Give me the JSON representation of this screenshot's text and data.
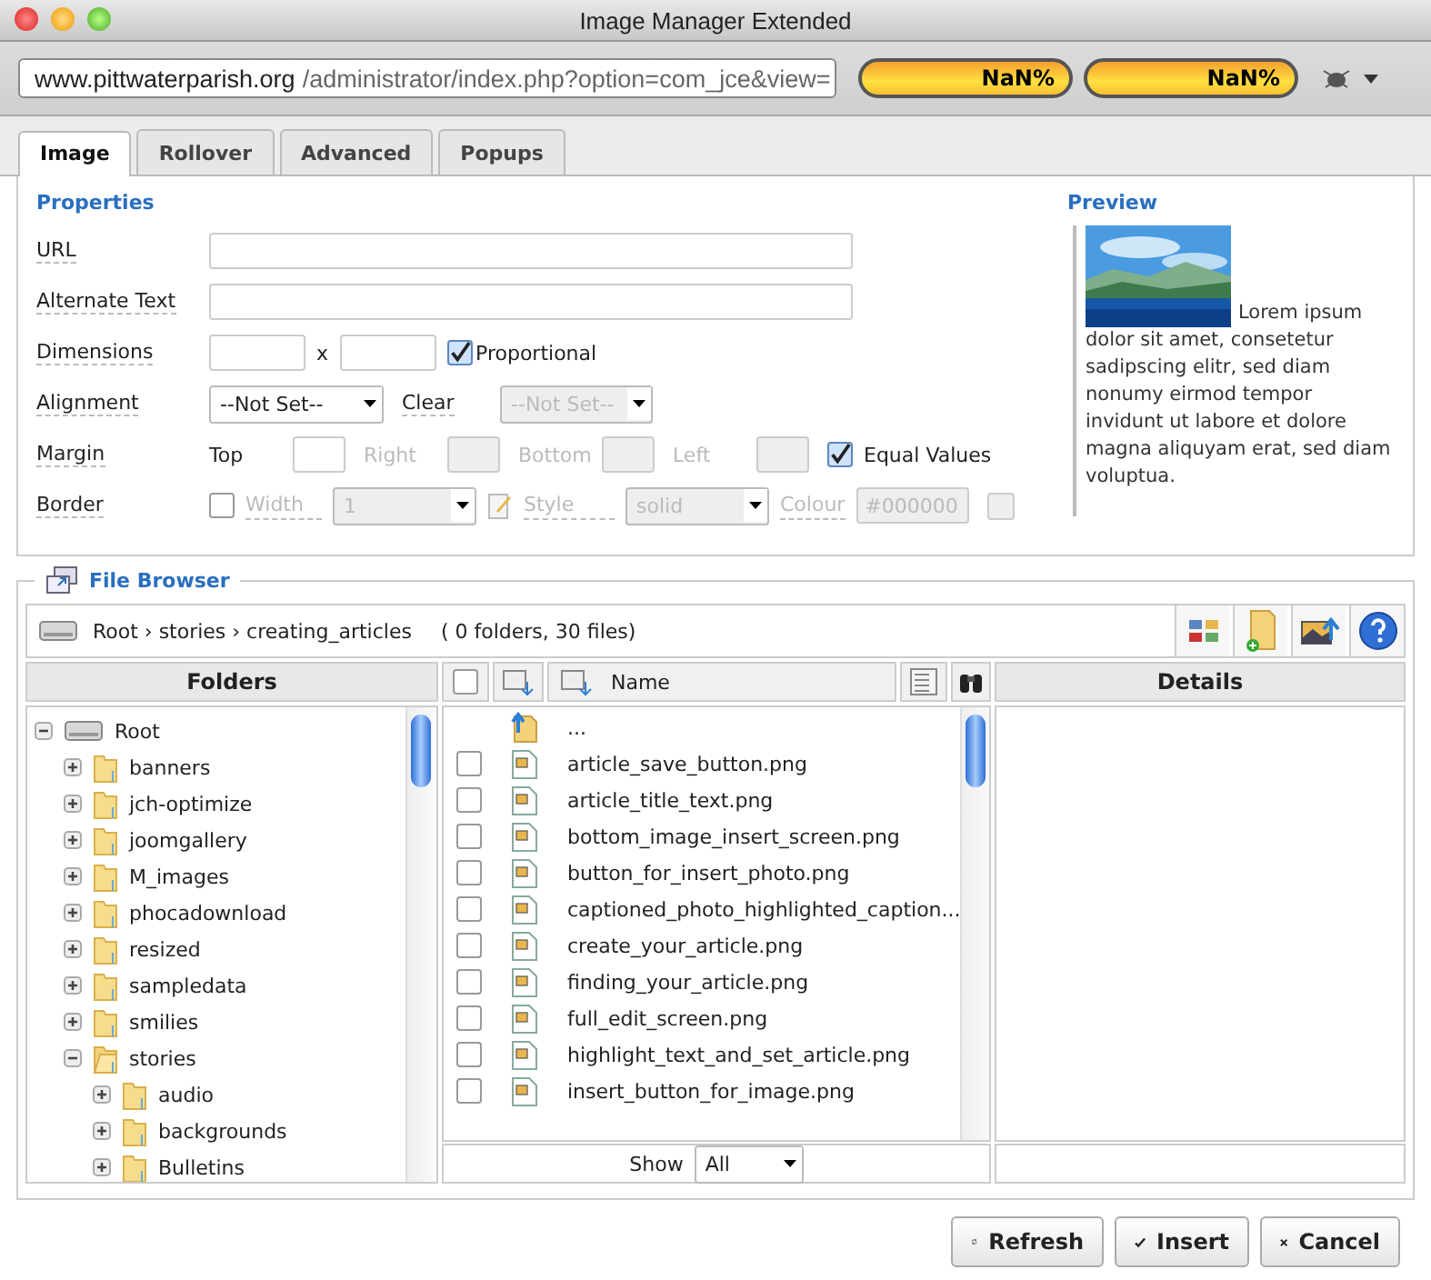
{
  "window": {
    "title": "Image Manager Extended"
  },
  "browser": {
    "address_host": "www.pittwaterparish.org",
    "address_path": "/administrator/index.php?option=com_jce&view=",
    "gauges": [
      "NaN%",
      "NaN%"
    ]
  },
  "tabs": [
    {
      "label": "Image",
      "selected": true
    },
    {
      "label": "Rollover",
      "selected": false
    },
    {
      "label": "Advanced",
      "selected": false
    },
    {
      "label": "Popups",
      "selected": false
    }
  ],
  "properties": {
    "title": "Properties",
    "url": {
      "label": "URL"
    },
    "alt_text": {
      "label": "Alternate Text"
    },
    "dimensions": {
      "label": "Dimensions",
      "separator": "x",
      "proportional": {
        "label": "Proportional",
        "checked": true
      }
    },
    "alignment": {
      "label": "Alignment",
      "value": "--Not Set--",
      "clear": {
        "label": "Clear",
        "value": "--Not Set--",
        "disabled": true
      }
    },
    "margin": {
      "label": "Margin",
      "sides": [
        {
          "label": "Top",
          "disabled": false
        },
        {
          "label": "Right",
          "disabled": true
        },
        {
          "label": "Bottom",
          "disabled": true
        },
        {
          "label": "Left",
          "disabled": true
        }
      ],
      "equal_values": {
        "label": "Equal Values",
        "checked": true
      }
    },
    "border": {
      "label": "Border",
      "checked": false,
      "width": {
        "label": "Width",
        "value": "1"
      },
      "style": {
        "label": "Style",
        "value": "solid"
      },
      "colour": {
        "label": "Colour",
        "value": "#000000"
      }
    }
  },
  "preview": {
    "title": "Preview",
    "text": [
      "Lorem ipsum",
      "dolor sit amet, consetetur sadipscing elitr, sed diam nonumy eirmod tempor invidunt ut labore et dolore magna aliquyam erat, sed diam voluptua."
    ]
  },
  "file_browser": {
    "title": "File Browser",
    "path": "Root › stories › creating_articles",
    "count": "( 0 folders, 30 files)",
    "folders": {
      "heading": "Folders",
      "tree": [
        {
          "name": "Root",
          "kind": "drive",
          "expanded": true,
          "children": [
            {
              "name": "banners",
              "kind": "folder",
              "expanded": false
            },
            {
              "name": "jch-optimize",
              "kind": "folder",
              "expanded": false
            },
            {
              "name": "joomgallery",
              "kind": "folder",
              "expanded": false
            },
            {
              "name": "M_images",
              "kind": "folder",
              "expanded": false
            },
            {
              "name": "phocadownload",
              "kind": "folder",
              "expanded": false
            },
            {
              "name": "resized",
              "kind": "folder",
              "expanded": false
            },
            {
              "name": "sampledata",
              "kind": "folder",
              "expanded": false
            },
            {
              "name": "smilies",
              "kind": "folder",
              "expanded": false
            },
            {
              "name": "stories",
              "kind": "folder",
              "expanded": true,
              "children": [
                {
                  "name": "audio",
                  "kind": "folder",
                  "expanded": false
                },
                {
                  "name": "backgrounds",
                  "kind": "folder",
                  "expanded": false
                },
                {
                  "name": "Bulletins",
                  "kind": "folder",
                  "expanded": false
                }
              ]
            }
          ]
        }
      ]
    },
    "files": {
      "select_all": {
        "checked": false
      },
      "name_heading": "Name",
      "show_label": "Show",
      "show_value": "All",
      "items": [
        {
          "name": "...",
          "kind": "parent"
        },
        {
          "name": "article_save_button.png",
          "kind": "file",
          "checked": false
        },
        {
          "name": "article_title_text.png",
          "kind": "file",
          "checked": false
        },
        {
          "name": "bottom_image_insert_screen.png",
          "kind": "file",
          "checked": false
        },
        {
          "name": "button_for_insert_photo.png",
          "kind": "file",
          "checked": false
        },
        {
          "name": "captioned_photo_highlighted_caption...",
          "kind": "file",
          "checked": false
        },
        {
          "name": "create_your_article.png",
          "kind": "file",
          "checked": false
        },
        {
          "name": "finding_your_article.png",
          "kind": "file",
          "checked": false
        },
        {
          "name": "full_edit_screen.png",
          "kind": "file",
          "checked": false
        },
        {
          "name": "highlight_text_and_set_article.png",
          "kind": "file",
          "checked": false
        },
        {
          "name": "insert_button_for_image.png",
          "kind": "file",
          "checked": false
        }
      ]
    },
    "details": {
      "heading": "Details"
    }
  },
  "buttons": [
    {
      "label": "Refresh",
      "kind": "refresh"
    },
    {
      "label": "Insert",
      "kind": "insert"
    },
    {
      "label": "Cancel",
      "kind": "cancel"
    }
  ]
}
